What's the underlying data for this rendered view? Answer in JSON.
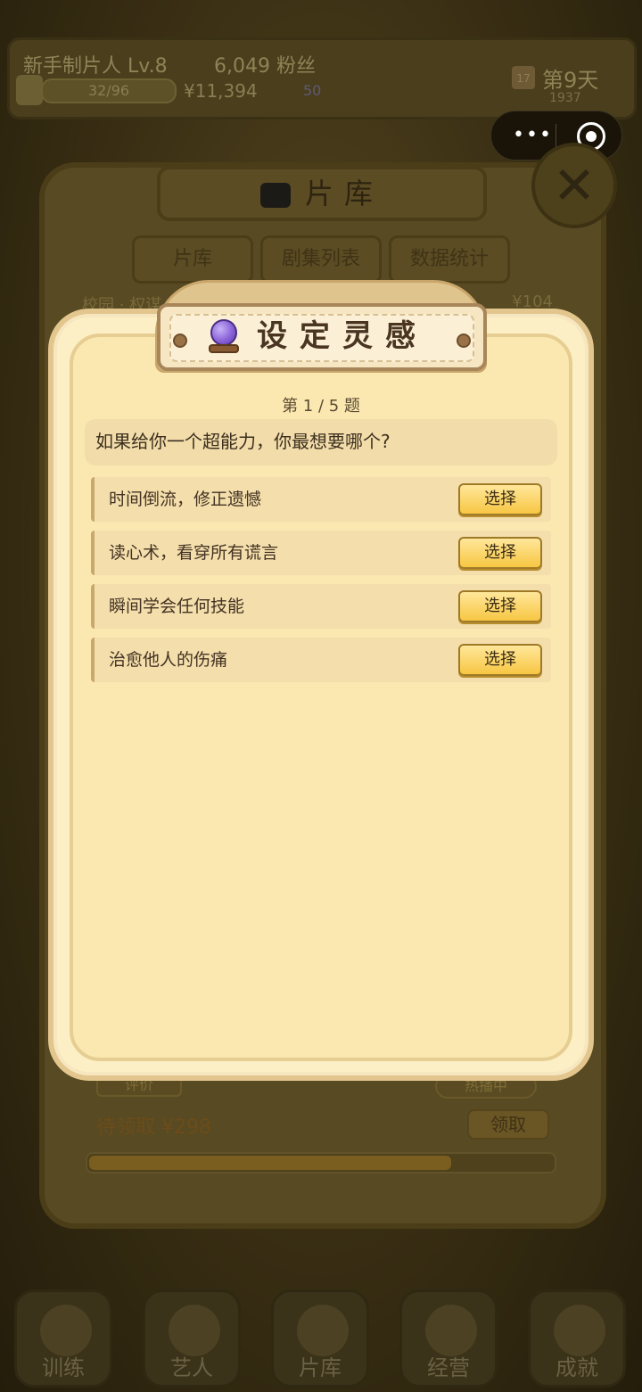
{
  "topbar": {
    "name": "新手制片人",
    "level": "Lv.8",
    "fans": "6,049 粉丝",
    "xp": "32/96",
    "money": "¥11,394",
    "gems": "50",
    "day": "第9天",
    "day_sub": "1937",
    "calendar_num": "17"
  },
  "library": {
    "title": "片库",
    "close_symbol": "✕",
    "tabs": [
      "片库",
      "剧集列表",
      "数据统计"
    ],
    "strip_text": "校园 · 权谋 · 玛丽",
    "strip_value": "¥104",
    "tag_left": "评价",
    "tag_right": "热播中",
    "pending": "待领取 ¥298",
    "collect": "领取",
    "bar_fill": 0.78
  },
  "modal": {
    "title": "设定灵感",
    "progress": "第 1 / 5 题",
    "question": "如果给你一个超能力，你最想要哪个?",
    "options": [
      {
        "text": "时间倒流，修正遗憾",
        "button": "选择"
      },
      {
        "text": "读心术，看穿所有谎言",
        "button": "选择"
      },
      {
        "text": "瞬间学会任何技能",
        "button": "选择"
      },
      {
        "text": "治愈他人的伤痛",
        "button": "选择"
      }
    ]
  },
  "nav": {
    "items": [
      {
        "label": "训练",
        "icon": "dumbbell-icon"
      },
      {
        "label": "艺人",
        "icon": "star-icon"
      },
      {
        "label": "片库",
        "icon": "film-reel-icon"
      },
      {
        "label": "经营",
        "icon": "shop-icon"
      },
      {
        "label": "成就",
        "icon": "trophy-icon"
      }
    ]
  },
  "capsule": {
    "more": "•••"
  },
  "colors": {
    "modal_bg": "#fdefc5",
    "button_gold": "#f7c743",
    "header_border": "#a9855a"
  }
}
